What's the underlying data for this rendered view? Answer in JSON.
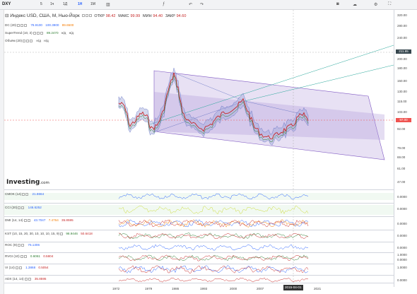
{
  "toolbar": {
    "symbol": "DXY",
    "intervals": [
      "5",
      "1ч",
      "1Д",
      "1Н",
      "1М"
    ],
    "active_interval": "1Н",
    "icons": [
      "chart-type-icon",
      "indicators-icon",
      "undo-icon",
      "redo-icon",
      "camera-icon",
      "save-icon",
      "settings-icon",
      "fullscreen-icon"
    ]
  },
  "legend": {
    "title": "Индекс USD, США, М, Нью-Йорк",
    "ohlc": [
      {
        "label": "ОТКР",
        "value": "98.42"
      },
      {
        "label": "МАКС",
        "value": "99.99"
      },
      {
        "label": "МИН",
        "value": "94.40"
      },
      {
        "label": "ЗАКР",
        "value": "94.60"
      }
    ],
    "dc": {
      "name": "DC (20)",
      "v1": "78.9100",
      "v2": "100.3900",
      "v3": "89.6500"
    },
    "supertrend": {
      "name": "SuperTrend (10, 3)",
      "v1": "89.2470",
      "v2": "н/д",
      "v3": "н/д"
    },
    "volume": {
      "name": "Объём (20)",
      "v1": "н/д",
      "v2": "н/д"
    }
  },
  "logo": {
    "main": "Investing",
    "suffix": ".com"
  },
  "price_axis": {
    "ticks": [
      "320.00",
      "280.00",
      "240.00",
      "200.00",
      "180.00",
      "150.00",
      "130.00",
      "115.00",
      "103.00",
      "92.00",
      "79.00",
      "69.00",
      "61.00",
      "47.00"
    ],
    "tags": [
      {
        "text": "211.95",
        "color": "#37474f"
      },
      {
        "text": "97.00",
        "color": "#ef5350"
      }
    ]
  },
  "indicators": [
    {
      "id": "cmo",
      "label": "CMOK (14)",
      "value": "21.8664",
      "value_color": "#2962ff",
      "ticks": [
        "0.0000"
      ]
    },
    {
      "id": "cci",
      "label": "CCI (20)",
      "value": "146.6252",
      "value_color": "#2962ff",
      "ticks": [
        "0.0000"
      ]
    },
    {
      "id": "dmi",
      "label": "DMI (14, 14)",
      "values": [
        "43.7047",
        "7.4764",
        "35.8595"
      ],
      "value_colors": [
        "#2962ff",
        "#f57c00",
        "#c62828"
      ],
      "ticks": [
        "0.0000"
      ]
    },
    {
      "id": "kst",
      "label": "KST (10, 15, 20, 30, 10, 10, 10, 15, 9)",
      "values": [
        "98.9446",
        "50.6418"
      ],
      "value_colors": [
        "#2e7d32",
        "#c62828"
      ],
      "ticks": [
        "0.0000"
      ]
    },
    {
      "id": "roc",
      "label": "ROC (9)",
      "value": "76.1306",
      "value_color": "#2962ff",
      "ticks": [
        "0.0000"
      ]
    },
    {
      "id": "rvgi",
      "label": "RVGI (10)",
      "values": [
        "0.6061",
        "0.5804"
      ],
      "value_colors": [
        "#2e7d32",
        "#c62828"
      ],
      "ticks": [
        "1.0000",
        "0.0000"
      ]
    },
    {
      "id": "vi",
      "label": "VI (14)",
      "values": [
        "1.3868",
        "0.5054"
      ],
      "value_colors": [
        "#2962ff",
        "#c62828"
      ],
      "ticks": [
        "1.0000"
      ]
    },
    {
      "id": "adx",
      "label": "ADX (14, 14)",
      "value": "35.8595",
      "value_color": "#c62828",
      "ticks": [
        "0.0000"
      ]
    }
  ],
  "time_axis": {
    "ticks": [
      "1972",
      "1979",
      "1986",
      "1993",
      "2000",
      "2007",
      "2014",
      "2021"
    ],
    "cursor": "2015-04-01"
  },
  "colors": {
    "channel_fill": "#b39ddb",
    "channel_stroke": "#7e57c2",
    "dc_fill": "#9fa8da",
    "candle_up": "#26a69a",
    "candle_down": "#ef5350",
    "trend_line": "#26a69a"
  }
}
